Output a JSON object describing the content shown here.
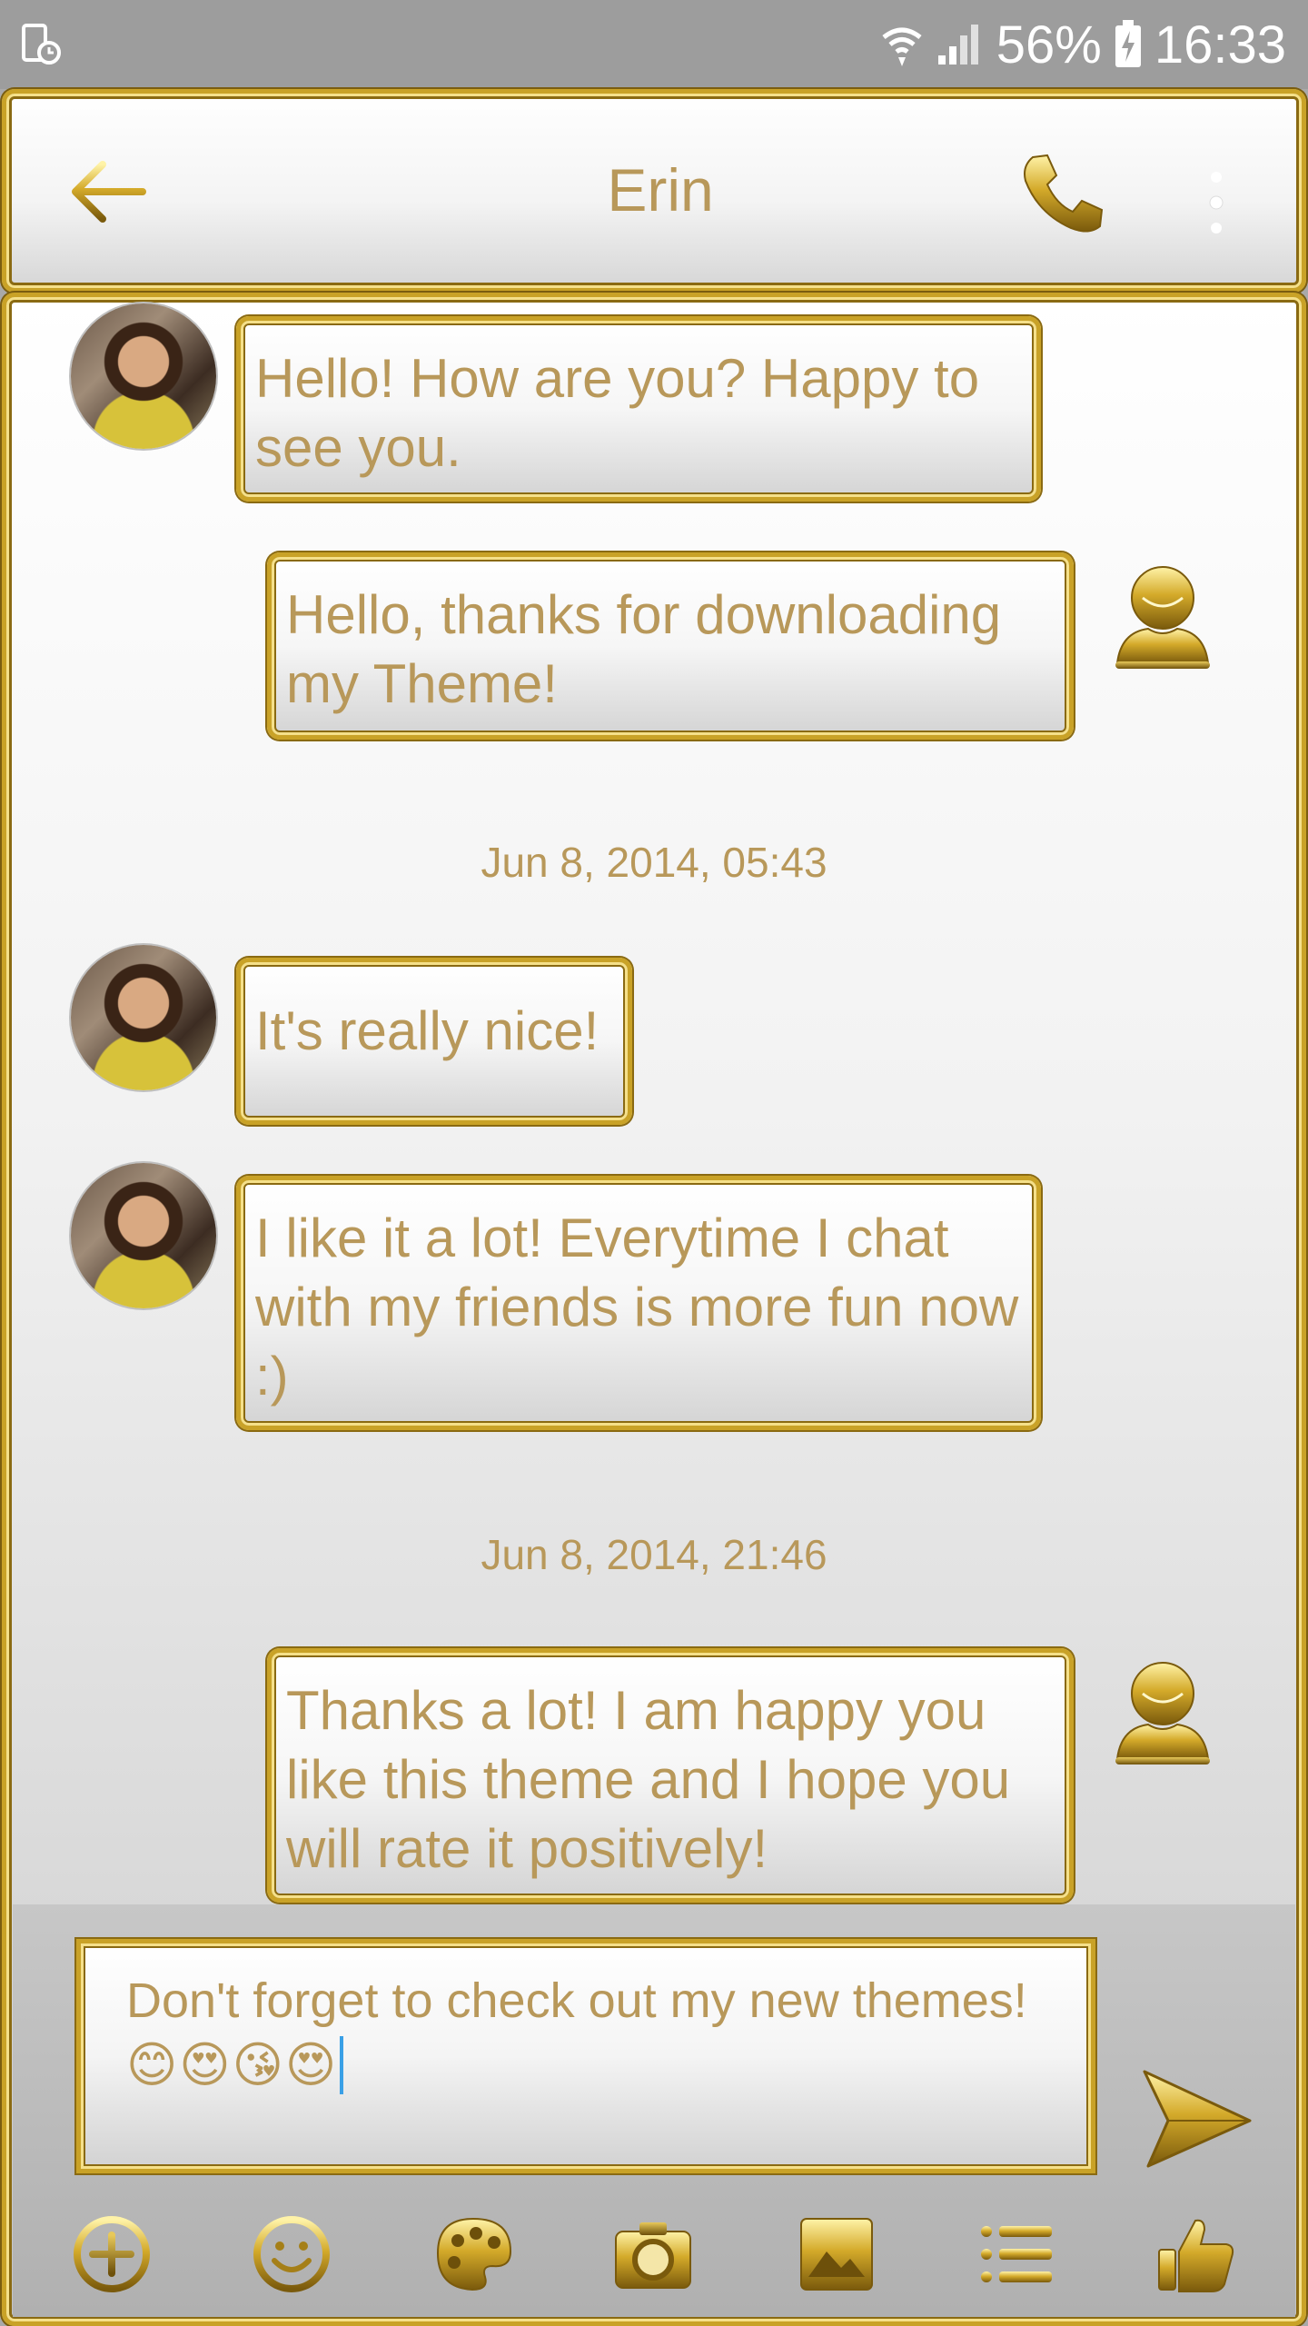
{
  "status_bar": {
    "battery": "56%",
    "time": "16:33"
  },
  "header": {
    "title": "Erin"
  },
  "messages": [
    {
      "side": "incoming",
      "text": "Hello! How are you? Happy to see you."
    },
    {
      "side": "outgoing",
      "text": "Hello, thanks for downloading my Theme!"
    },
    {
      "side": "incoming",
      "text": "It's really nice!"
    },
    {
      "side": "incoming",
      "text": "I like it a lot! Everytime I chat with my friends is more fun now :)"
    },
    {
      "side": "outgoing",
      "text": "Thanks a lot! I am happy you like this theme and I hope you will rate it positively!"
    }
  ],
  "timestamps": [
    "Jun 8, 2014, 05:43",
    "Jun 8, 2014, 21:46"
  ],
  "composer": {
    "text": "Don't forget to check out my new themes!",
    "emojis": [
      "😊",
      "😍",
      "😘",
      "😍"
    ]
  },
  "toolbar": {
    "icons": [
      "add-circle-icon",
      "smiley-icon",
      "palette-icon",
      "camera-icon",
      "image-icon",
      "list-icon",
      "thumbs-up-icon"
    ]
  },
  "colors": {
    "gold": "#c9a227",
    "text_gold": "#b8985a",
    "caret": "#3aa0e6"
  }
}
